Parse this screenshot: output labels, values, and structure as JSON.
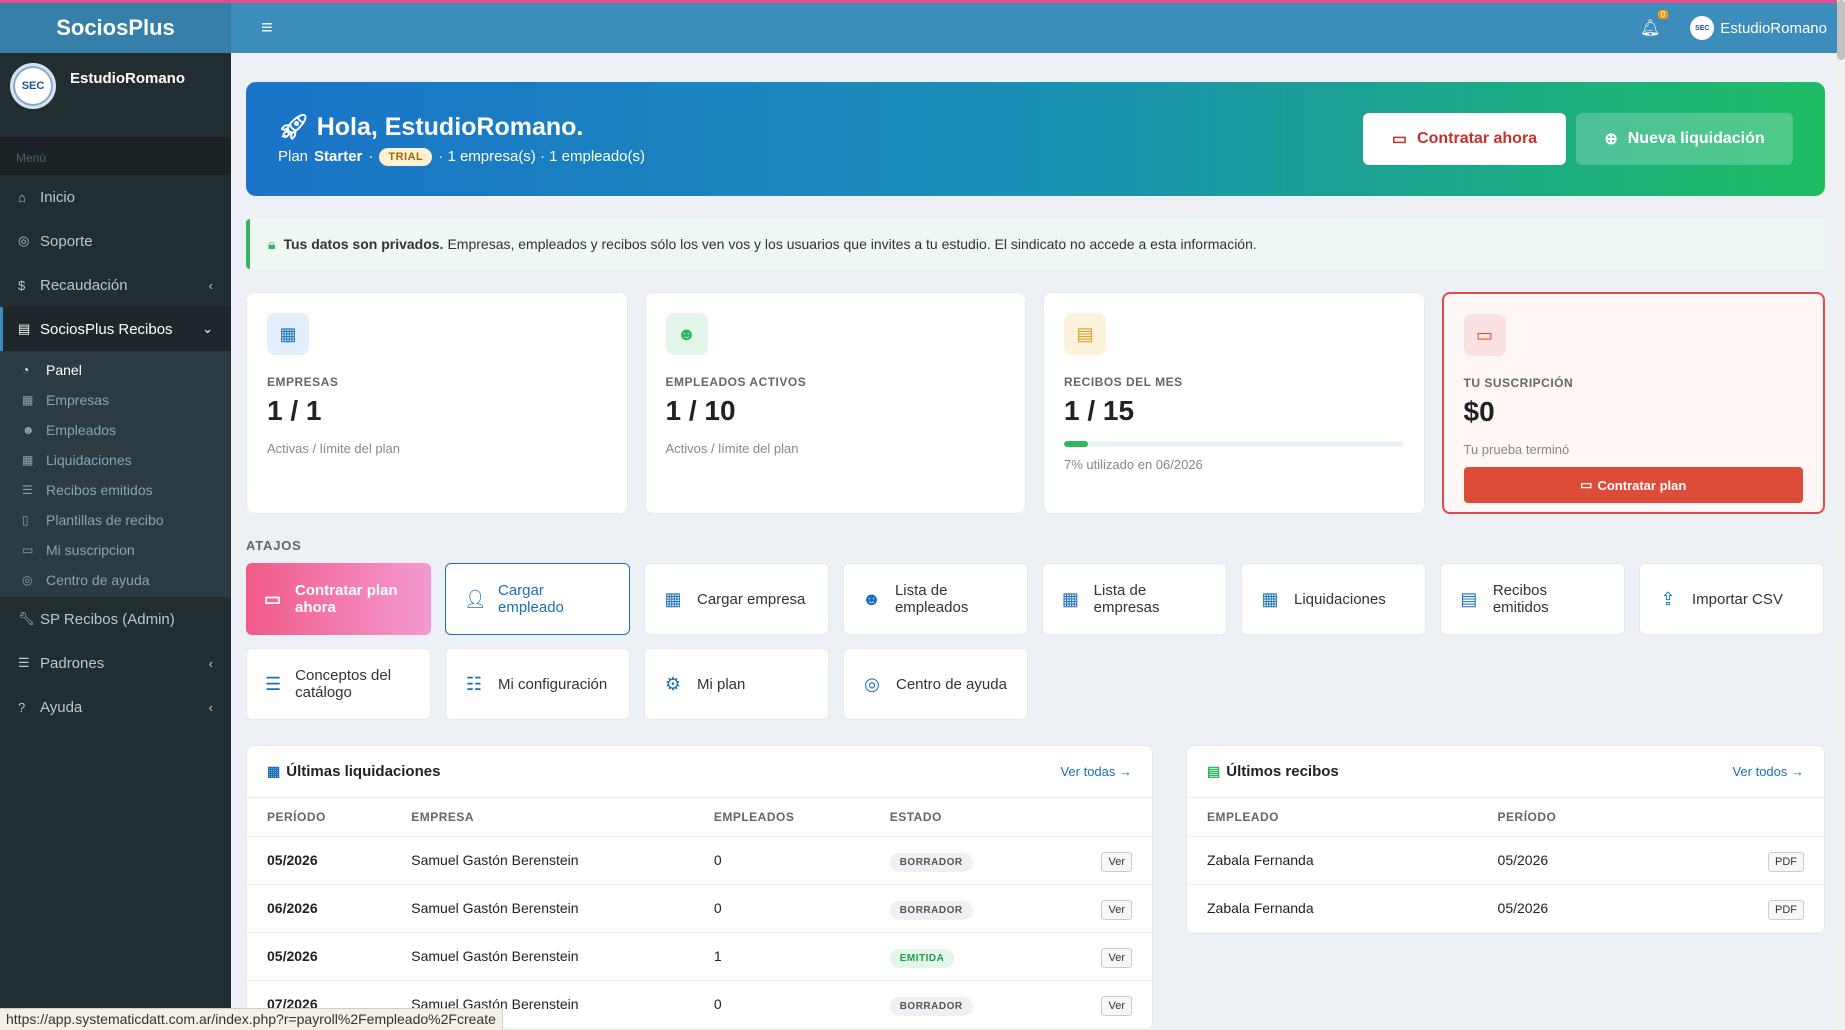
{
  "brand": "SociosPlus",
  "sidebar": {
    "username": "EstudioRomano",
    "avatar_text": "SEC",
    "menu_header": "Menú",
    "items": [
      {
        "label": "Inicio",
        "icon": "home-icon"
      },
      {
        "label": "Soporte",
        "icon": "lifebuoy-icon"
      },
      {
        "label": "Recaudación",
        "icon": "dollar-icon"
      },
      {
        "label": "SociosPlus Recibos",
        "icon": "file-icon"
      }
    ],
    "subitems": [
      {
        "label": "Panel"
      },
      {
        "label": "Empresas"
      },
      {
        "label": "Empleados"
      },
      {
        "label": "Liquidaciones"
      },
      {
        "label": "Recibos emitidos"
      },
      {
        "label": "Plantillas de recibo"
      },
      {
        "label": "Mi suscripcion"
      },
      {
        "label": "Centro de ayuda"
      }
    ],
    "items_after": [
      {
        "label": "SP Recibos (Admin)"
      },
      {
        "label": "Padrones"
      },
      {
        "label": "Ayuda"
      }
    ]
  },
  "topbar": {
    "notifications_count": "0",
    "username": "EstudioRomano"
  },
  "hero": {
    "greeting": "Hola, EstudioRomano.",
    "plan_prefix": "Plan",
    "plan_name": "Starter",
    "dot": "·",
    "badge": "TRIAL",
    "counts": "· 1 empresa(s) · 1 empleado(s)",
    "primary_button": "Contratar ahora",
    "secondary_button": "Nueva liquidación"
  },
  "privacy": {
    "bold": "Tus datos son privados.",
    "text": "Empresas, empleados y recibos sólo los ven vos y los usuarios que invites a tu estudio. El sindicato no accede a esta información."
  },
  "stats": [
    {
      "label": "EMPRESAS",
      "value": "1 / 1",
      "note": "Activas / límite del plan"
    },
    {
      "label": "EMPLEADOS ACTIVOS",
      "value": "1 / 10",
      "note": "Activos / límite del plan"
    },
    {
      "label": "RECIBOS DEL MES",
      "value": "1 / 15",
      "note": "7% utilizado en 06/2026",
      "progress": 0.07
    },
    {
      "label": "TU SUSCRIPCIÓN",
      "value": "$0",
      "note": "Tu prueba terminó",
      "button": "Contratar plan"
    }
  ],
  "shortcuts_title": "ATAJOS",
  "shortcuts": [
    {
      "label": "Contratar plan ahora",
      "icon": "credit-card-icon"
    },
    {
      "label": "Cargar empleado",
      "icon": "user-plus-icon"
    },
    {
      "label": "Cargar empresa",
      "icon": "building-icon"
    },
    {
      "label": "Lista de empleados",
      "icon": "users-icon"
    },
    {
      "label": "Lista de empresas",
      "icon": "building-icon"
    },
    {
      "label": "Liquidaciones",
      "icon": "calculator-icon"
    },
    {
      "label": "Recibos emitidos",
      "icon": "file-icon"
    },
    {
      "label": "Importar CSV",
      "icon": "upload-icon"
    },
    {
      "label": "Conceptos del catálogo",
      "icon": "list-icon"
    },
    {
      "label": "Mi configuración",
      "icon": "sliders-icon"
    },
    {
      "label": "Mi plan",
      "icon": "gear-icon"
    },
    {
      "label": "Centro de ayuda",
      "icon": "lifebuoy-icon"
    }
  ],
  "liquidaciones": {
    "title": "Últimas liquidaciones",
    "link": "Ver todas →",
    "headers": [
      "PERÍODO",
      "EMPRESA",
      "EMPLEADOS",
      "ESTADO"
    ],
    "rows": [
      {
        "periodo": "05/2026",
        "empresa": "Samuel Gastón Berenstein",
        "empleados": "0",
        "estado": "BORRADOR",
        "action": "Ver"
      },
      {
        "periodo": "06/2026",
        "empresa": "Samuel Gastón Berenstein",
        "empleados": "0",
        "estado": "BORRADOR",
        "action": "Ver"
      },
      {
        "periodo": "05/2026",
        "empresa": "Samuel Gastón Berenstein",
        "empleados": "1",
        "estado": "EMITIDA",
        "action": "Ver"
      },
      {
        "periodo": "07/2026",
        "empresa": "Samuel Gastón Berenstein",
        "empleados": "0",
        "estado": "BORRADOR",
        "action": "Ver"
      }
    ]
  },
  "recibos": {
    "title": "Últimos recibos",
    "link": "Ver todos →",
    "headers": [
      "EMPLEADO",
      "PERÍODO"
    ],
    "rows": [
      {
        "empleado": "Zabala Fernanda",
        "periodo": "05/2026",
        "action": "PDF"
      },
      {
        "empleado": "Zabala Fernanda",
        "periodo": "05/2026",
        "action": "PDF"
      }
    ]
  },
  "statusbar_url": "https://app.systematicdatt.com.ar/index.php?r=payroll%2Fempleado%2Fcreate",
  "colors": {
    "primary": "#3c8dbc",
    "sidebar": "#222d32",
    "danger": "#dd4b39",
    "success": "#2fb65e",
    "pink": "#f15a87"
  }
}
